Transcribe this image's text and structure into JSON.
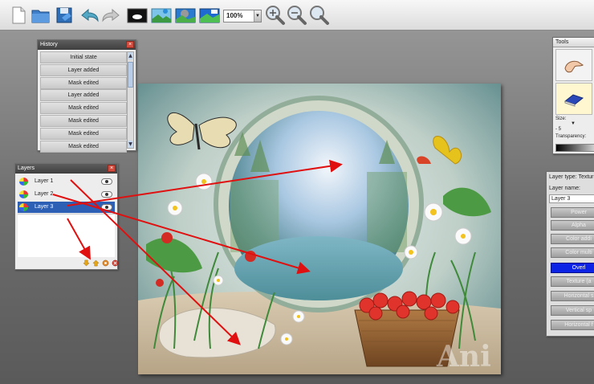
{
  "toolbar": {
    "zoom_value": "100%"
  },
  "history": {
    "title": "History",
    "items": [
      "Initial state",
      "Layer added",
      "Mask edited",
      "Layer added",
      "Mask edited",
      "Mask edited",
      "Mask edited",
      "Mask edited"
    ]
  },
  "layers": {
    "title": "Layers",
    "items": [
      {
        "label": "Layer 1",
        "selected": false
      },
      {
        "label": "Layer 2",
        "selected": false
      },
      {
        "label": "Layer 3",
        "selected": true
      }
    ]
  },
  "tools": {
    "title": "Tools",
    "size_label": "Size:",
    "size_value": "- 5",
    "transparency_label": "Transparency:"
  },
  "layer_type": {
    "type_label": "Layer type: Textur",
    "name_label": "Layer name:",
    "name_value": "Layer 3",
    "buttons": [
      "Power",
      "Alpha",
      "Color addi",
      "Color multi",
      "Overl",
      "Texture (a",
      "Horizontal s",
      "Vertical sp",
      "Horizontal f"
    ],
    "active_index": 4
  },
  "canvas": {
    "watermark": "Ani"
  },
  "colors": {
    "selected_row": "#2d5fb5",
    "active_blend": "#0c23e6",
    "annotation_arrow": "#e01010"
  }
}
